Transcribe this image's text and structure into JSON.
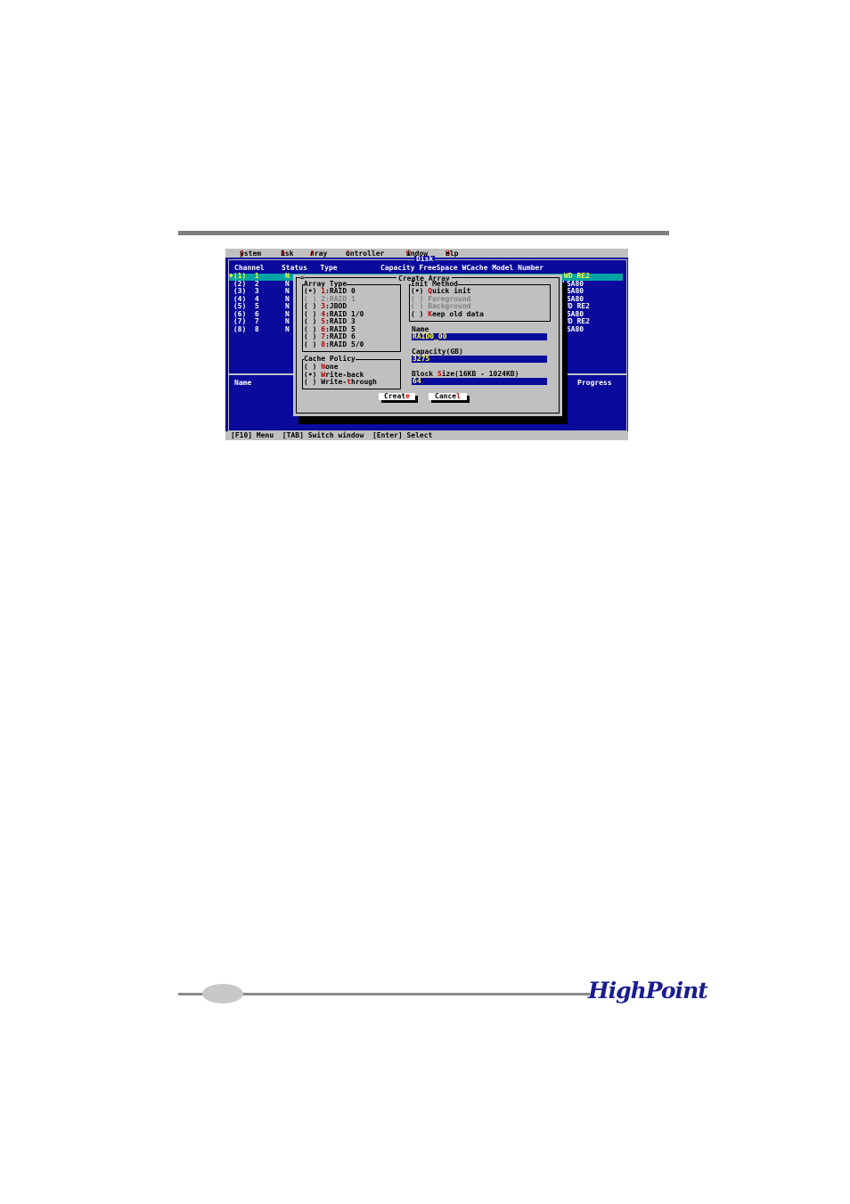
{
  "menu": {
    "items": [
      {
        "hotkey": "S",
        "rest": "ystem"
      },
      {
        "hotkey": "D",
        "rest": "isk"
      },
      {
        "hotkey": "A",
        "rest": "rray"
      },
      {
        "hotkey": "C",
        "rest": "ontroller"
      },
      {
        "hotkey": "W",
        "rest": "indow"
      },
      {
        "hotkey": "H",
        "rest": "elp"
      }
    ]
  },
  "disk_panel": {
    "title": "Disk",
    "header_left": "Channel    Status   Type",
    "header_right": "Capacity FreeSpace WCache Model Number",
    "rows": [
      {
        "channel": "♦(1)  1",
        "status": "N",
        "model": "WD RE2"
      },
      {
        "channel": " (2)  2",
        "status": "N",
        "model": "LSA80"
      },
      {
        "channel": " (3)  3",
        "status": "N",
        "model": "LSA80"
      },
      {
        "channel": " (4)  4",
        "status": "N",
        "model": "LSA80"
      },
      {
        "channel": " (5)  5",
        "status": "N",
        "model": "WD RE2"
      },
      {
        "channel": " (6)  6",
        "status": "N",
        "model": "LSA80"
      },
      {
        "channel": " (7)  7",
        "status": "N",
        "model": "WD RE2"
      },
      {
        "channel": " (8)  8",
        "status": "N",
        "model": "LSA80"
      }
    ]
  },
  "task_panel": {
    "col_name": "Name",
    "col_progress": "Progress"
  },
  "dialog": {
    "title": "Create Array",
    "close_glyph": "=",
    "array_type": {
      "title": "Array Type",
      "options": [
        {
          "radio": "(•)",
          "num": "1",
          "label": ":RAID 0",
          "disabled": false
        },
        {
          "radio": "( )",
          "num": "2",
          "label": ":RAID 1",
          "disabled": true
        },
        {
          "radio": "( )",
          "num": "3",
          "label": ":JBOD",
          "disabled": false
        },
        {
          "radio": "( )",
          "num": "4",
          "label": ":RAID 1/0",
          "disabled": false
        },
        {
          "radio": "( )",
          "num": "5",
          "label": ":RAID 3",
          "disabled": false
        },
        {
          "radio": "( )",
          "num": "6",
          "label": ":RAID 5",
          "disabled": false
        },
        {
          "radio": "( )",
          "num": "7",
          "label": ":RAID 6",
          "disabled": false
        },
        {
          "radio": "( )",
          "num": "8",
          "label": ":RAID 5/0",
          "disabled": false
        }
      ]
    },
    "init_method": {
      "title": "Init Method",
      "options": [
        {
          "radio": "(•)",
          "label": "Quick init",
          "hotkey": "Q",
          "rest": "uick init",
          "disabled": false
        },
        {
          "radio": "( )",
          "label": "Foreground",
          "disabled": true
        },
        {
          "radio": "( )",
          "label": "Background",
          "disabled": true
        },
        {
          "radio": "( )",
          "label": "Keep old data",
          "hotkey": "K",
          "rest": "eep old data",
          "disabled": false
        }
      ]
    },
    "name_label": "Name",
    "name_value": "RAID0_00",
    "capacity_label": "Capacity(GB)",
    "capacity_value": "3275",
    "block_label_pre": "Block ",
    "block_label_hotkey": "S",
    "block_label_post": "ize(16KB - 1024KB)",
    "block_value": "64",
    "cache_policy": {
      "title": "Cache Policy",
      "options": [
        {
          "radio": "( )",
          "pre": "",
          "hotkey": "N",
          "post": "one"
        },
        {
          "radio": "(•)",
          "pre": "",
          "hotkey": "W",
          "post": "rite-back"
        },
        {
          "radio": "( )",
          "pre": "Write-",
          "hotkey": "t",
          "post": "hrough"
        }
      ]
    },
    "create_pre": "Creat",
    "create_hotkey": "e",
    "cancel_pre": "Cance",
    "cancel_hotkey": "l"
  },
  "statusbar": "[F10] Menu  [TAB] Switch window  [Enter] Select",
  "logo": "HighPoint",
  "colors": {
    "screen_bg": "#0a0a9c",
    "dialog_bg": "#c0c0c0",
    "hotkey": "#c00000",
    "highlight": "#00a3a3"
  }
}
